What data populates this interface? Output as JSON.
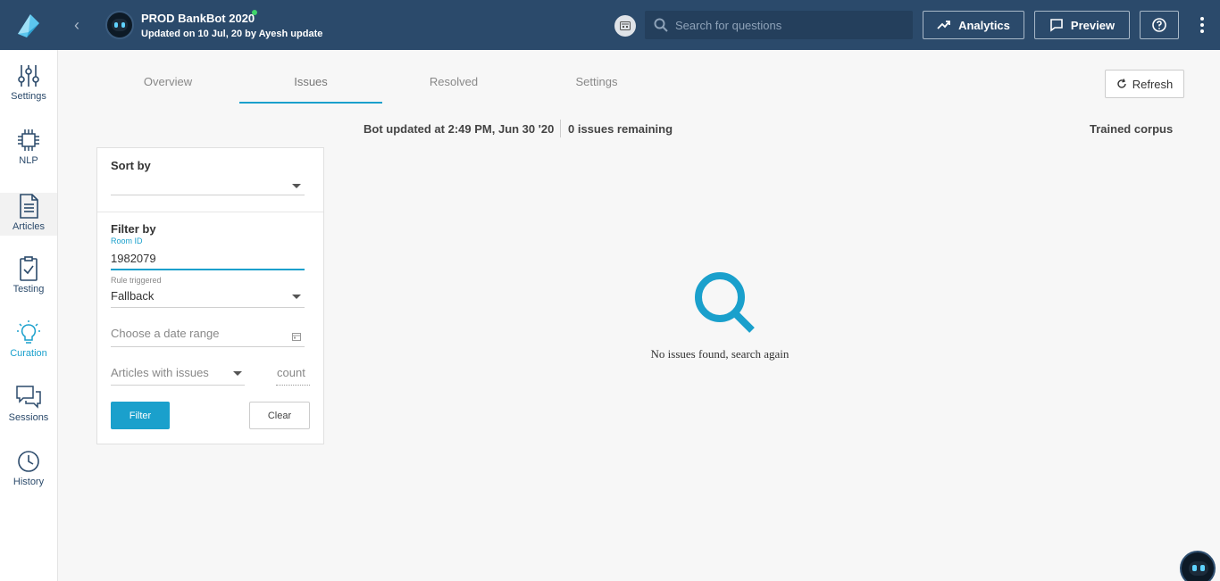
{
  "header": {
    "bot_name": "PROD BankBot 2020",
    "updated_text": "Updated on 10 Jul, 20 by Ayesh update",
    "search_placeholder": "Search for questions",
    "analytics_label": "Analytics",
    "preview_label": "Preview"
  },
  "sidebar": {
    "items": [
      {
        "label": "Settings",
        "icon": "sliders-icon"
      },
      {
        "label": "NLP",
        "icon": "chip-icon"
      },
      {
        "label": "Articles",
        "icon": "document-icon"
      },
      {
        "label": "Testing",
        "icon": "clipboard-check-icon"
      },
      {
        "label": "Curation",
        "icon": "lightbulb-icon"
      },
      {
        "label": "Sessions",
        "icon": "chat-bubbles-icon"
      },
      {
        "label": "History",
        "icon": "clock-icon"
      }
    ]
  },
  "tabs": [
    {
      "label": "Overview"
    },
    {
      "label": "Issues"
    },
    {
      "label": "Resolved"
    },
    {
      "label": "Settings"
    }
  ],
  "active_tab": "Issues",
  "refresh_label": "Refresh",
  "status": {
    "bot_updated": "Bot updated at 2:49 PM, Jun 30 '20",
    "issues_remaining": "0 issues remaining",
    "trained_corpus": "Trained corpus"
  },
  "filters": {
    "sort_by_label": "Sort by",
    "sort_by_value": "",
    "filter_by_label": "Filter by",
    "room_id_label": "Room ID",
    "room_id_value": "1982079",
    "rule_triggered_label": "Rule triggered",
    "rule_triggered_value": "Fallback",
    "date_range_placeholder": "Choose a date range",
    "articles_placeholder": "Articles with issues",
    "count_placeholder": "count",
    "filter_button": "Filter",
    "clear_button": "Clear"
  },
  "empty_state": {
    "message": "No issues found, search again"
  },
  "colors": {
    "header_bg": "#2b4a6b",
    "accent": "#1aa0cc",
    "online": "#3fd46a"
  }
}
